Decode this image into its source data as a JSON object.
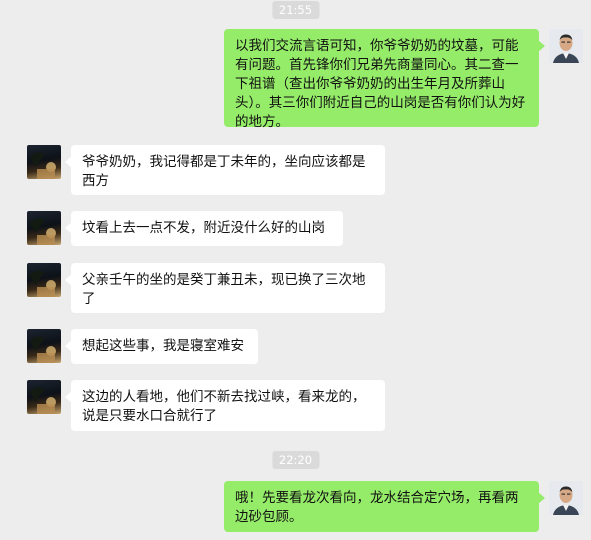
{
  "timestamps": [
    "21:55",
    "22:20"
  ],
  "messages": [
    {
      "side": "self",
      "text": "以我们交流言语可知，你爷爷奶奶的坟墓，可能有问题。首先锋你们兄弟先商量同心。其二查一下祖谱（查出你爷爷奶奶的出生年月及所葬山头）。其三你们附近自己的山岗是否有你们认为好的地方。"
    },
    {
      "side": "other",
      "text": "爷爷奶奶，我记得都是丁未年的，坐向应该都是西方"
    },
    {
      "side": "other",
      "text": "坟看上去一点不发，附近没什么好的山岗"
    },
    {
      "side": "other",
      "text": "父亲壬午的坐的是癸丁兼丑未，现已换了三次地了"
    },
    {
      "side": "other",
      "text": "想起这些事，我是寝室难安"
    },
    {
      "side": "other",
      "text": "这边的人看地，他们不新去找过峡，看来龙的，说是只要水口合就行了"
    },
    {
      "side": "self",
      "text": "哦！先要看龙次看向，龙水结合定穴场，再看两边砂包顾。"
    }
  ],
  "icons": {
    "self_avatar": "user-photo-avatar",
    "other_avatar": "night-photo-avatar"
  },
  "colors": {
    "background": "#ededed",
    "self_bubble": "#95ec69",
    "other_bubble": "#ffffff",
    "timestamp_bg": "#dadada"
  }
}
